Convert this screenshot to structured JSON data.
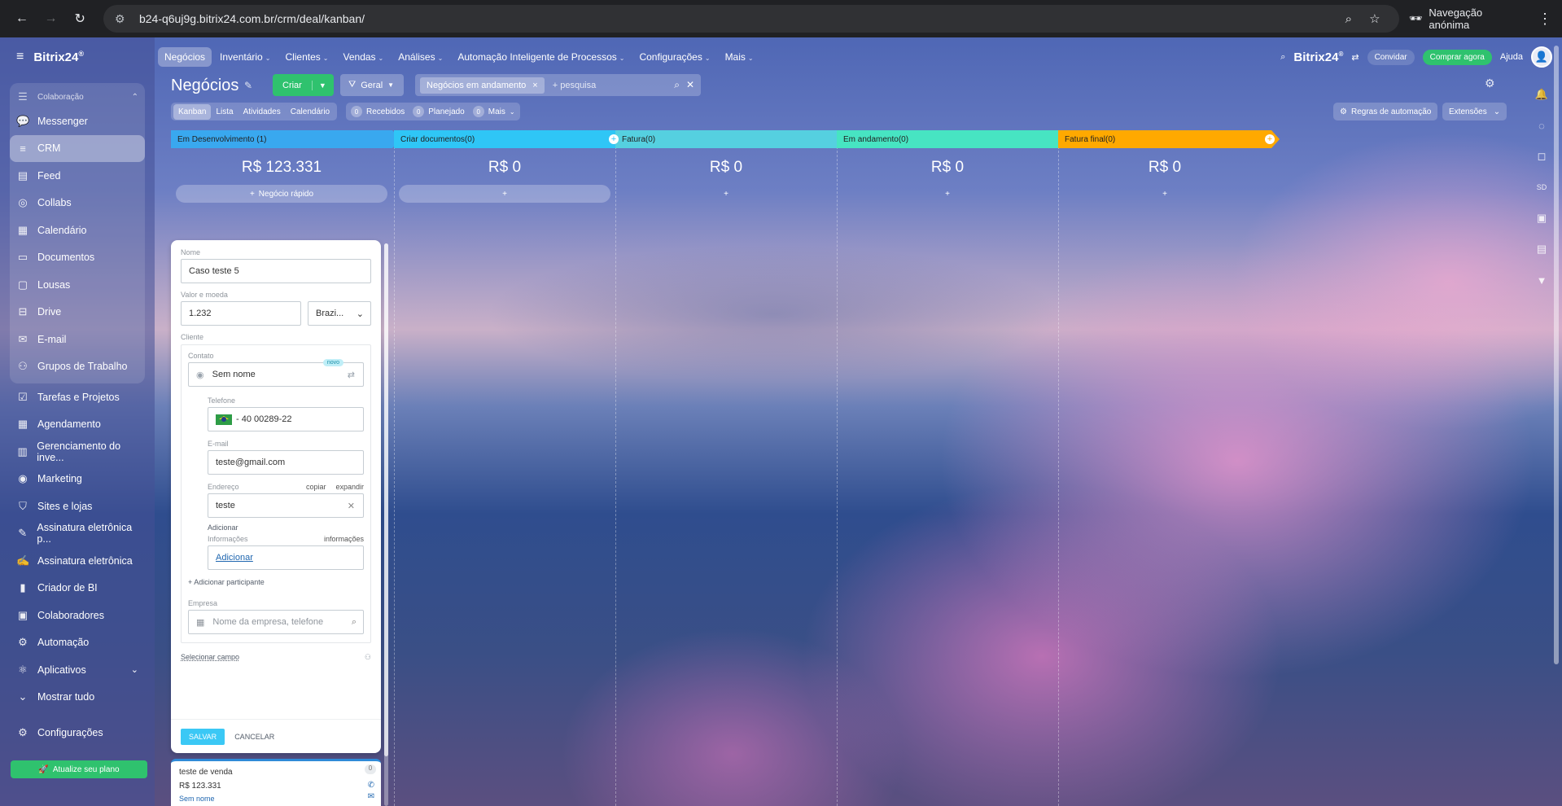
{
  "browser": {
    "url": "b24-q6uj9g.bitrix24.com.br/crm/deal/kanban/",
    "incognito_label": "Navegação anónima"
  },
  "sidebar": {
    "logo": "Bitrix24",
    "items": [
      {
        "label": "Colaboração",
        "icon": "collab-group-icon"
      },
      {
        "label": "Messenger",
        "icon": "chat-icon"
      },
      {
        "label": "CRM",
        "icon": "filter-icon"
      },
      {
        "label": "Feed",
        "icon": "feed-icon"
      },
      {
        "label": "Collabs",
        "icon": "collabs-icon"
      },
      {
        "label": "Calendário",
        "icon": "calendar-icon"
      },
      {
        "label": "Documentos",
        "icon": "documents-icon"
      },
      {
        "label": "Lousas",
        "icon": "board-icon"
      },
      {
        "label": "Drive",
        "icon": "drive-icon"
      },
      {
        "label": "E-mail",
        "icon": "mail-icon"
      },
      {
        "label": "Grupos de Trabalho",
        "icon": "groups-icon"
      },
      {
        "label": "Tarefas e Projetos",
        "icon": "tasks-icon"
      },
      {
        "label": "Agendamento",
        "icon": "booking-icon"
      },
      {
        "label": "Gerenciamento do inve...",
        "icon": "inventory-icon"
      },
      {
        "label": "Marketing",
        "icon": "marketing-icon"
      },
      {
        "label": "Sites e lojas",
        "icon": "store-icon"
      },
      {
        "label": "Assinatura eletrônica p...",
        "icon": "sign-icon"
      },
      {
        "label": "Assinatura eletrônica",
        "icon": "signature-icon"
      },
      {
        "label": "Criador de BI",
        "icon": "chart-icon"
      },
      {
        "label": "Colaboradores",
        "icon": "employees-icon"
      },
      {
        "label": "Automação",
        "icon": "automation-icon"
      },
      {
        "label": "Aplicativos",
        "icon": "apps-icon"
      },
      {
        "label": "Mostrar tudo",
        "icon": "chevron-down-icon"
      },
      {
        "label": "Configurações",
        "icon": "gear-icon"
      }
    ],
    "upgrade_label": "Atualize seu plano"
  },
  "topnav": {
    "items": [
      "Negócios",
      "Inventário",
      "Clientes",
      "Vendas",
      "Análises",
      "Automação Inteligente de Processos",
      "Configurações",
      "Mais"
    ],
    "logo": "Bitrix24",
    "invite": "Convidar",
    "buy": "Comprar agora",
    "help": "Ajuda"
  },
  "page": {
    "title": "Negócios",
    "create_label": "Criar",
    "geral_label": "Geral",
    "filter_tag": "Negócios em andamento",
    "search_placeholder": "+ pesquisa",
    "views": [
      "Kanban",
      "Lista",
      "Atividades",
      "Calendário"
    ],
    "counters": [
      {
        "num": "0",
        "label": "Recebidos"
      },
      {
        "num": "0",
        "label": "Planejado"
      },
      {
        "num": "0",
        "label": "Mais"
      }
    ],
    "automation_label": "Regras de automação",
    "extensions_label": "Extensões"
  },
  "columns": [
    {
      "title": "Em Desenvolvimento",
      "count": "(1)",
      "sum": "R$ 123.331",
      "add": "Negócio rápido",
      "color": "#39a8ef"
    },
    {
      "title": "Criar documentos",
      "count": "(0)",
      "sum": "R$ 0",
      "add": "+",
      "color": "#2fc6f6"
    },
    {
      "title": "Fatura",
      "count": "(0)",
      "sum": "R$ 0",
      "add": "+",
      "color": "#55d0e0"
    },
    {
      "title": "Em andamento",
      "count": "(0)",
      "sum": "R$ 0",
      "add": "+",
      "color": "#47e4c2"
    },
    {
      "title": "Fatura final",
      "count": "(0)",
      "sum": "R$ 0",
      "add": "+",
      "color": "#ffa900"
    }
  ],
  "quick_form": {
    "name_label": "Nome",
    "name_value": "Caso teste 5",
    "value_label": "Valor e moeda",
    "value_value": "1.232",
    "currency_value": "Brazi...",
    "client_label": "Cliente",
    "contact_label": "Contato",
    "novo_badge": "novo",
    "contact_value": "Sem nome",
    "phone_label": "Telefone",
    "phone_value": "- 40 00289-22",
    "email_label": "E-mail",
    "email_value": "teste@gmail.com",
    "address_label": "Endereço",
    "copy_label": "copiar",
    "expand_label": "expandir",
    "address_value": "teste",
    "add_label": "Adicionar",
    "info_label": "Informações",
    "info_right": "informações",
    "info_add": "Adicionar",
    "add_participant": "+ Adicionar participante",
    "company_label": "Empresa",
    "company_placeholder": "Nome da empresa, telefone",
    "select_field": "Selecionar campo",
    "save": "SALVAR",
    "cancel": "CANCELAR"
  },
  "deal_card": {
    "title": "teste de venda",
    "amount": "R$ 123.331",
    "contact": "Sem nome",
    "count": "0"
  }
}
